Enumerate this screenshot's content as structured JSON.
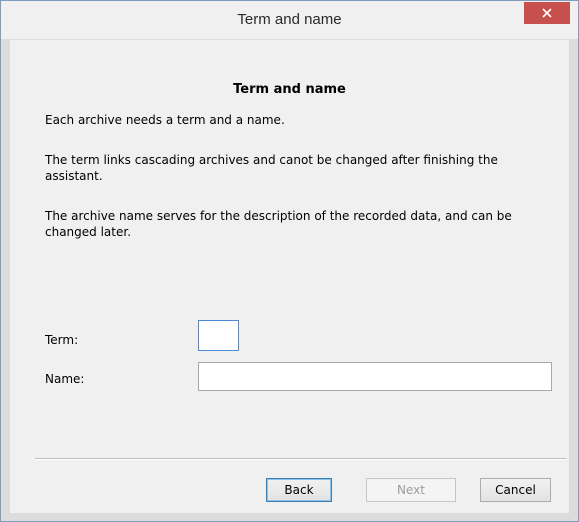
{
  "window": {
    "title": "Term and name",
    "close_icon": "close-icon"
  },
  "content": {
    "heading": "Term and name",
    "paragraphs": [
      "Each archive needs a term and a name.",
      "The term links cascading archives and canot be changed after finishing the assistant.",
      "The archive name serves for the description of the recorded data, and can be changed later."
    ]
  },
  "form": {
    "term_label": "Term:",
    "term_value": "",
    "name_label": "Name:",
    "name_value": ""
  },
  "buttons": {
    "back": "Back",
    "next": "Next",
    "cancel": "Cancel"
  },
  "colors": {
    "close_button": "#c7504c",
    "focus_border": "#4b8bd6",
    "default_button_border": "#3c7fb1"
  }
}
